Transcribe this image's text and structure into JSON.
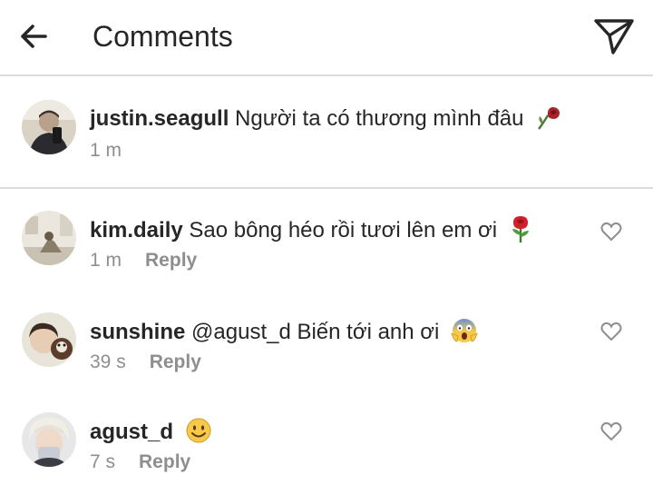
{
  "header": {
    "title": "Comments",
    "back_icon": "arrow-left-icon",
    "send_icon": "paper-plane-icon"
  },
  "caption": {
    "username": "justin.seagull",
    "text": "Người ta có thương mình đâu",
    "emoji": "wilted-rose",
    "time": "1 m"
  },
  "comments": [
    {
      "username": "kim.daily",
      "text": "Sao bông héo rồi tươi lên em ơi",
      "emoji": "rose",
      "time": "1 m",
      "reply_label": "Reply"
    },
    {
      "username": "sunshine",
      "text": "@agust_d Biến tới anh ơi",
      "emoji": "screaming-face",
      "time": "39 s",
      "reply_label": "Reply"
    },
    {
      "username": "agust_d",
      "text": "",
      "emoji": "smiling-face",
      "time": "7 s",
      "reply_label": "Reply"
    }
  ],
  "colors": {
    "text": "#262626",
    "muted": "#8e8e8e",
    "divider": "#dbdbdb"
  }
}
